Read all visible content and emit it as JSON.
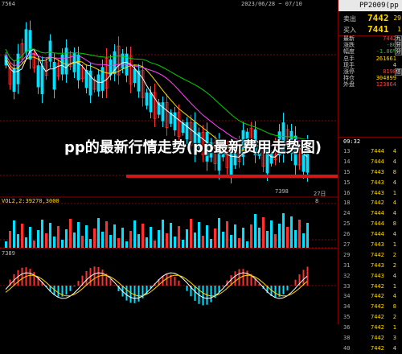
{
  "chart": {
    "top_value": "7564",
    "top_dates": "2023/06/28 ~ 07/10",
    "vol_label": "VOL2,2:39270,3000",
    "macd_label": "7389",
    "min_price_label": "7398",
    "right_date_label": "27日",
    "right_day_label": "8",
    "overlay_title": "pp的最新行情走势(pp最新费用走势图)"
  },
  "quote": {
    "code": "PP2009",
    "code_suffix": "(pp",
    "sell_label": "卖出",
    "sell_price": "7442",
    "sell_vol": "29",
    "buy_label": "买入",
    "buy_price": "7441",
    "buy_vol": "1",
    "stats": [
      {
        "k": "最新",
        "v": "7442",
        "color": "#ff4040"
      },
      {
        "k": "涨跌",
        "v": "-80",
        "color": "#00e000"
      },
      {
        "k": "幅度",
        "v": "-1.06%",
        "color": "#00e000"
      },
      {
        "k": "总手",
        "v": "261661",
        "color": "#ffd800"
      },
      {
        "k": "现手",
        "v": "4",
        "color": "#ffd800"
      },
      {
        "k": "涨停",
        "v": "8198",
        "color": "#ff4040"
      },
      {
        "k": "持仓",
        "v": "304899",
        "color": "#ffd800"
      },
      {
        "k": "外盘",
        "v": "123864",
        "color": "#ff4040"
      }
    ],
    "tags": [
      "九",
      "分",
      "分",
      "信"
    ],
    "tick_time": "09:32",
    "ticks": [
      {
        "t": "13",
        "p": "7444",
        "q": "4"
      },
      {
        "t": "14",
        "p": "7444",
        "q": "4"
      },
      {
        "t": "15",
        "p": "7443",
        "q": "8"
      },
      {
        "t": "15",
        "p": "7443",
        "q": "4"
      },
      {
        "t": "16",
        "p": "7443",
        "q": "1"
      },
      {
        "t": "18",
        "p": "7442",
        "q": "4"
      },
      {
        "t": "24",
        "p": "7444",
        "q": "4"
      },
      {
        "t": "25",
        "p": "7444",
        "q": "8"
      },
      {
        "t": "26",
        "p": "7444",
        "q": "4"
      },
      {
        "t": "27",
        "p": "7443",
        "q": "1"
      },
      {
        "t": "29",
        "p": "7442",
        "q": "2"
      },
      {
        "t": "31",
        "p": "7443",
        "q": "2"
      },
      {
        "t": "32",
        "p": "7443",
        "q": "4"
      },
      {
        "t": "33",
        "p": "7442",
        "q": "1"
      },
      {
        "t": "34",
        "p": "7442",
        "q": "4"
      },
      {
        "t": "34",
        "p": "7442",
        "q": "8"
      },
      {
        "t": "35",
        "p": "7442",
        "q": "2"
      },
      {
        "t": "36",
        "p": "7442",
        "q": "1"
      },
      {
        "t": "38",
        "p": "7442",
        "q": "3"
      },
      {
        "t": "40",
        "p": "7442",
        "q": "4"
      }
    ]
  },
  "colors": {
    "up": "#ff3030",
    "down": "#00e0ff",
    "ma1": "#ffffff",
    "ma2": "#ffd800",
    "ma3": "#ff40ff",
    "ma4": "#00d000"
  }
}
